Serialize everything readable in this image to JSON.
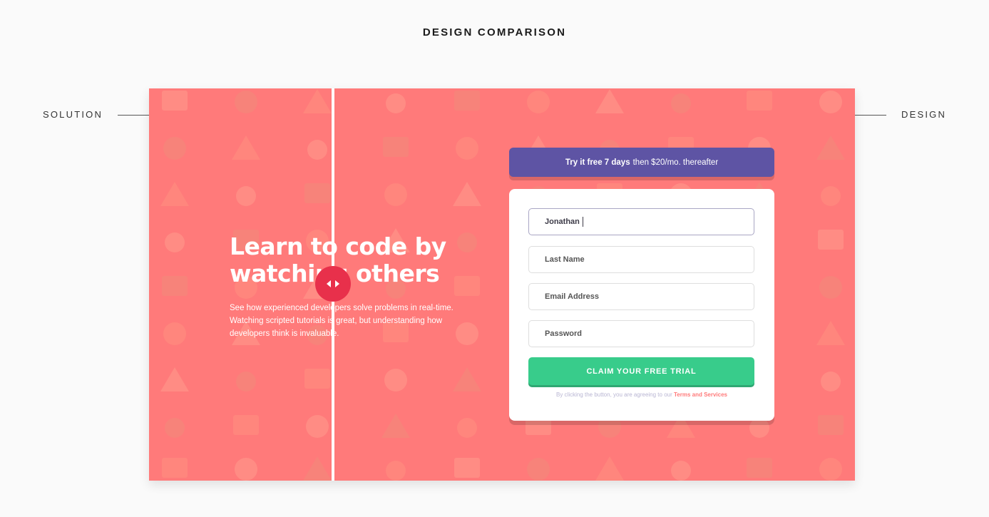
{
  "page": {
    "heading": "DESIGN COMPARISON"
  },
  "labels": {
    "solution": "SOLUTION",
    "design": "DESIGN"
  },
  "colors": {
    "background": "#ff7a7a",
    "promo": "#5e54a4",
    "cta": "#38cc8b",
    "handle": "#e8304b"
  },
  "hero": {
    "title": "Learn to code by watching others",
    "text": "See how experienced developers solve problems in real-time. Watching scripted tutorials is great, but understanding how developers think is invaluable."
  },
  "promo": {
    "bold": "Try it free 7 days",
    "rest": "then $20/mo. thereafter"
  },
  "form": {
    "first_name_value": "Jonathan",
    "last_name_placeholder": "Last Name",
    "email_placeholder": "Email Address",
    "password_placeholder": "Password",
    "cta_label": "CLAIM YOUR FREE TRIAL",
    "terms_text": "By clicking the button, you are agreeing to our",
    "terms_link": "Terms and Services"
  },
  "comparison": {
    "handle_icon": "left-right-arrows-icon",
    "split_position": 0.26
  }
}
